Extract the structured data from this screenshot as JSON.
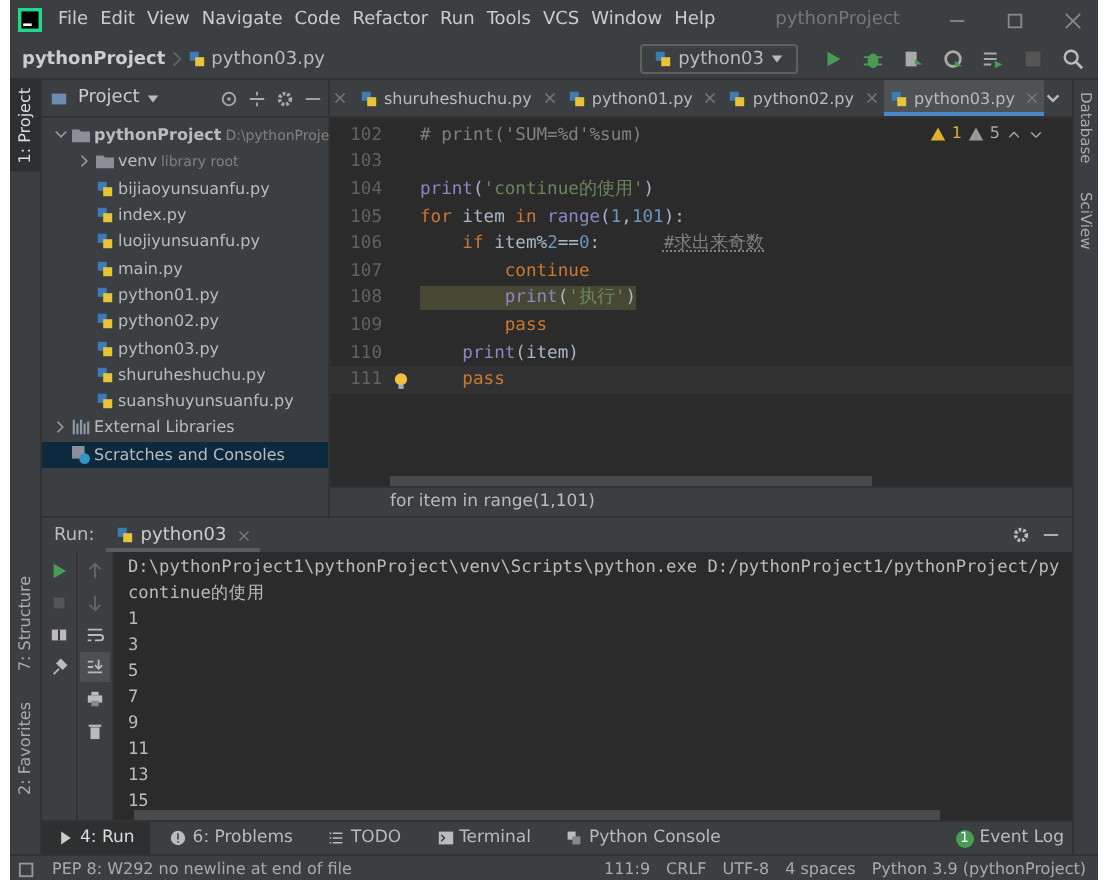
{
  "menu": [
    "File",
    "Edit",
    "View",
    "Navigate",
    "Code",
    "Refactor",
    "Run",
    "Tools",
    "VCS",
    "Window",
    "Help"
  ],
  "window": {
    "title": "pythonProject"
  },
  "breadcrumb": {
    "project": "pythonProject",
    "file": "python03.py"
  },
  "run_config": "python03",
  "left_stripe": [
    {
      "label": "1: Project",
      "selected": true
    },
    {
      "label": "7: Structure",
      "selected": false
    },
    {
      "label": "2: Favorites",
      "selected": false
    }
  ],
  "right_stripe": [
    "Database",
    "SciView"
  ],
  "project_panel": {
    "title": "Project",
    "tree": [
      {
        "label": "pythonProject",
        "hint": "D:\\pythonProje",
        "kind": "folder",
        "expanded": true,
        "selected": false,
        "children": [
          {
            "label": "venv",
            "hint": "library root",
            "kind": "folder",
            "expanded": false,
            "selected": false
          },
          {
            "label": "bijiaoyunsuanfu.py",
            "kind": "python",
            "selected": false
          },
          {
            "label": "index.py",
            "kind": "python",
            "selected": false
          },
          {
            "label": "luojiyunsuanfu.py",
            "kind": "python",
            "selected": false
          },
          {
            "label": "main.py",
            "kind": "python",
            "selected": false
          },
          {
            "label": "python01.py",
            "kind": "python",
            "selected": false
          },
          {
            "label": "python02.py",
            "kind": "python",
            "selected": false
          },
          {
            "label": "python03.py",
            "kind": "python",
            "selected": false
          },
          {
            "label": "shuruheshuchu.py",
            "kind": "python",
            "selected": false
          },
          {
            "label": "suanshuyunsuanfu.py",
            "kind": "python",
            "selected": false
          }
        ]
      },
      {
        "label": "External Libraries",
        "kind": "library",
        "expanded": false,
        "selected": false
      },
      {
        "label": "Scratches and Consoles",
        "kind": "scratch",
        "selected": true
      }
    ]
  },
  "editor_tabs": [
    {
      "label": "shuruheshuchu.py",
      "selected": false
    },
    {
      "label": "python01.py",
      "selected": false
    },
    {
      "label": "python02.py",
      "selected": false
    },
    {
      "label": "python03.py",
      "selected": true
    }
  ],
  "inspections": {
    "warnings": "1",
    "weak_warnings": "5"
  },
  "code": [
    {
      "number": "102",
      "current": false,
      "highlighted": false,
      "tokens": [
        {
          "kind": "comment",
          "text": "# print('SUM=%d'%sum)"
        }
      ]
    },
    {
      "number": "103",
      "current": false,
      "highlighted": false
    },
    {
      "number": "104",
      "current": false,
      "highlighted": false,
      "tokens": [
        {
          "kind": "builtin",
          "text": "print"
        },
        {
          "kind": "plain",
          "text": "("
        },
        {
          "kind": "string",
          "text": "'continue的使用'"
        },
        {
          "kind": "plain",
          "text": ")"
        }
      ]
    },
    {
      "number": "105",
      "current": false,
      "highlighted": false,
      "tokens": [
        {
          "kind": "keyword",
          "text": "for"
        },
        {
          "kind": "plain",
          "text": " item "
        },
        {
          "kind": "keyword",
          "text": "in"
        },
        {
          "kind": "builtin",
          "text": " range"
        },
        {
          "kind": "plain",
          "text": "("
        },
        {
          "kind": "number",
          "text": "1"
        },
        {
          "kind": "plain",
          "text": ","
        },
        {
          "kind": "number",
          "text": "101"
        },
        {
          "kind": "plain",
          "text": "):"
        }
      ]
    },
    {
      "number": "106",
      "current": false,
      "highlighted": false,
      "tokens": [
        {
          "kind": "keyword",
          "text": "    if"
        },
        {
          "kind": "plain",
          "text": " item%"
        },
        {
          "kind": "number",
          "text": "2"
        },
        {
          "kind": "plain",
          "text": "=="
        },
        {
          "kind": "number",
          "text": "0"
        },
        {
          "kind": "plain",
          "text": ":      "
        },
        {
          "kind": "comment",
          "text": "#求出来奇数"
        }
      ]
    },
    {
      "number": "107",
      "current": false,
      "highlighted": false,
      "tokens": [
        {
          "kind": "keyword",
          "text": "        continue"
        }
      ]
    },
    {
      "number": "108",
      "current": false,
      "highlighted": true,
      "tokens": [
        {
          "kind": "builtin",
          "text": "        print"
        },
        {
          "kind": "plain",
          "text": "("
        },
        {
          "kind": "string",
          "text": "'执行'"
        },
        {
          "kind": "plain",
          "text": ")"
        }
      ]
    },
    {
      "number": "109",
      "current": false,
      "highlighted": false,
      "tokens": [
        {
          "kind": "keyword",
          "text": "        pass"
        }
      ]
    },
    {
      "number": "110",
      "current": false,
      "highlighted": false,
      "tokens": [
        {
          "kind": "builtin",
          "text": "    print"
        },
        {
          "kind": "plain",
          "text": "(item)"
        }
      ]
    },
    {
      "number": "111",
      "current": true,
      "highlighted": false,
      "tokens": [
        {
          "kind": "keyword",
          "text": "    pass"
        }
      ]
    }
  ],
  "editor_breadcrumb": "for item in range(1,101)",
  "run": {
    "label": "Run:",
    "tab": "python03",
    "output": [
      "D:\\pythonProject1\\pythonProject\\venv\\Scripts\\python.exe D:/pythonProject1/pythonProject/py",
      "continue的使用",
      "1",
      "3",
      "5",
      "7",
      "9",
      "11",
      "13",
      "15"
    ]
  },
  "bottom_tabs": [
    {
      "label": "4: Run",
      "kind": "run",
      "selected": true
    },
    {
      "label": "6: Problems",
      "kind": "problems",
      "selected": false
    },
    {
      "label": "TODO",
      "kind": "todo",
      "selected": false
    },
    {
      "label": "Terminal",
      "kind": "terminal",
      "selected": false
    },
    {
      "label": "Python Console",
      "kind": "console",
      "selected": false
    }
  ],
  "event_log": {
    "label": "Event Log",
    "count": "1"
  },
  "status": {
    "message": "PEP 8: W292 no newline at end of file",
    "position": "111:9",
    "line_separator": "CRLF",
    "encoding": "UTF-8",
    "indent": "4 spaces",
    "interpreter": "Python 3.9 (pythonProject)"
  }
}
